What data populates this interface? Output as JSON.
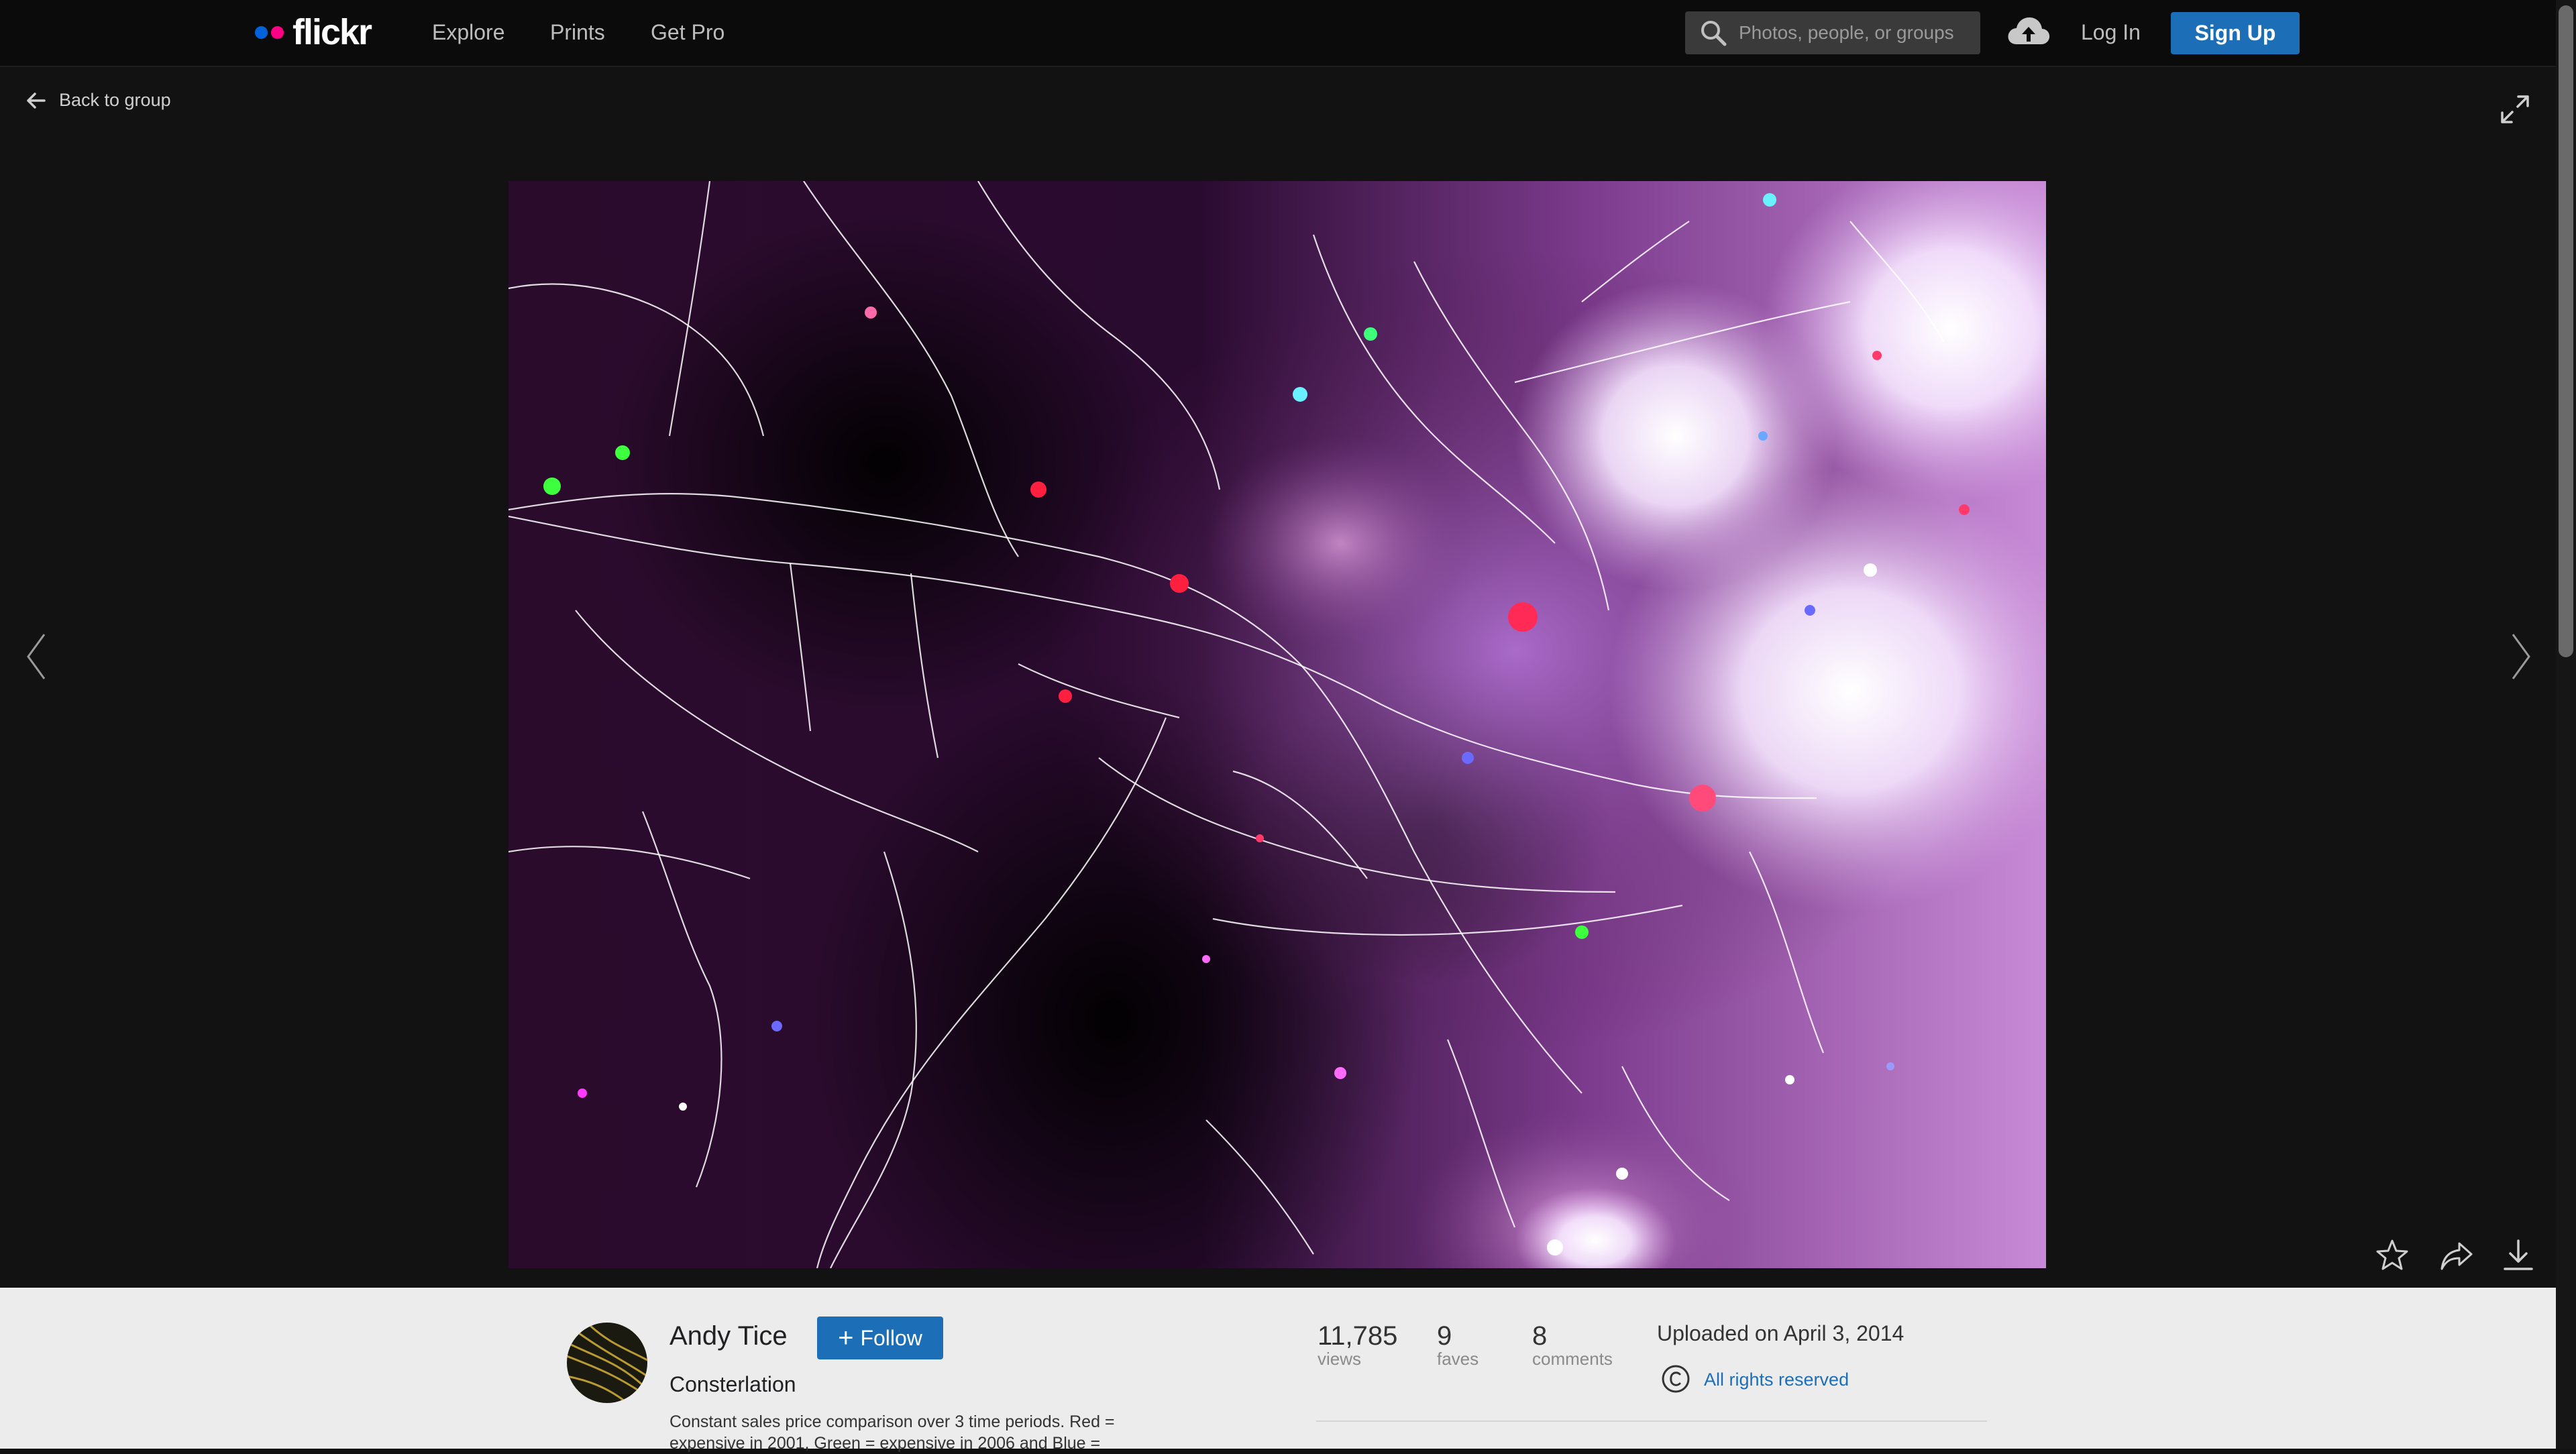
{
  "header": {
    "brand": "flickr",
    "brand_colors": {
      "dot1": "#0063dc",
      "dot2": "#ff0084"
    },
    "nav": [
      "Explore",
      "Prints",
      "Get Pro"
    ],
    "search_placeholder": "Photos, people, or groups",
    "login": "Log In",
    "signup": "Sign Up",
    "upload_icon": "cloud-upload-icon"
  },
  "viewer": {
    "back_label": "Back to group",
    "icons": [
      "arrow-left-icon",
      "expand-icon",
      "chevron-left-icon",
      "chevron-right-icon"
    ],
    "photo_subject": "Constellation sales-price heat map",
    "actions": [
      "star-icon",
      "share-icon",
      "download-icon"
    ]
  },
  "info": {
    "author": "Andy Tice",
    "follow_label": "Follow",
    "title": "Consterlation",
    "description": "Constant sales price comparison over 3 time periods. Red = expensive in 2001, Green = expensive in 2006 and Blue =",
    "stats": [
      {
        "value": "11,785",
        "label": "views"
      },
      {
        "value": "9",
        "label": "faves"
      },
      {
        "value": "8",
        "label": "comments"
      }
    ],
    "uploaded": "Uploaded on April 3, 2014",
    "license": "All rights reserved"
  }
}
